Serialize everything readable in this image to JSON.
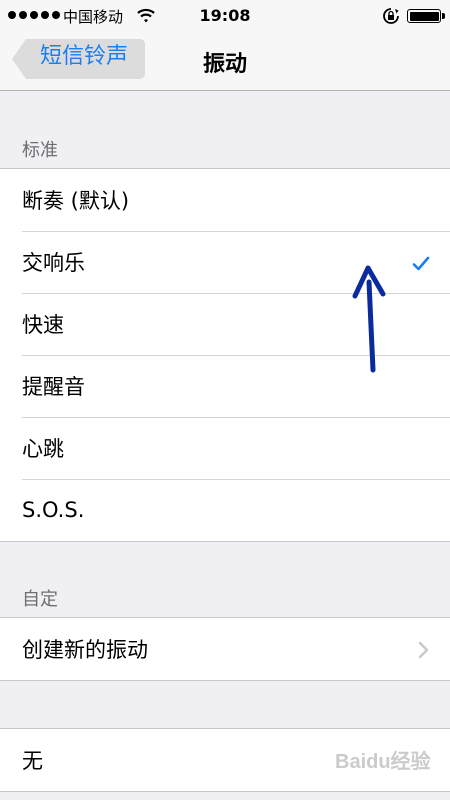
{
  "status_bar": {
    "carrier": "中国移动",
    "time": "19:08",
    "icons": [
      "signal-dots-icon",
      "wifi-icon",
      "rotation-lock-icon",
      "battery-icon"
    ]
  },
  "nav_bar": {
    "back_label": "短信铃声",
    "title": "振动"
  },
  "sections": [
    {
      "header": "标准",
      "items": [
        {
          "label": "断奏 (默认)",
          "selected": false
        },
        {
          "label": "交响乐",
          "selected": true
        },
        {
          "label": "快速",
          "selected": false
        },
        {
          "label": "提醒音",
          "selected": false
        },
        {
          "label": "心跳",
          "selected": false
        },
        {
          "label": "S.O.S.",
          "selected": false
        }
      ]
    },
    {
      "header": "自定",
      "items": [
        {
          "label": "创建新的振动",
          "disclosure": true
        }
      ]
    },
    {
      "header": "",
      "items": [
        {
          "label": "无",
          "selected": false
        }
      ]
    }
  ],
  "watermark": "Baidu经验",
  "colors": {
    "accent": "#1a7ef0",
    "background": "#efeff4",
    "annotation_arrow": "#0a2a9e"
  }
}
